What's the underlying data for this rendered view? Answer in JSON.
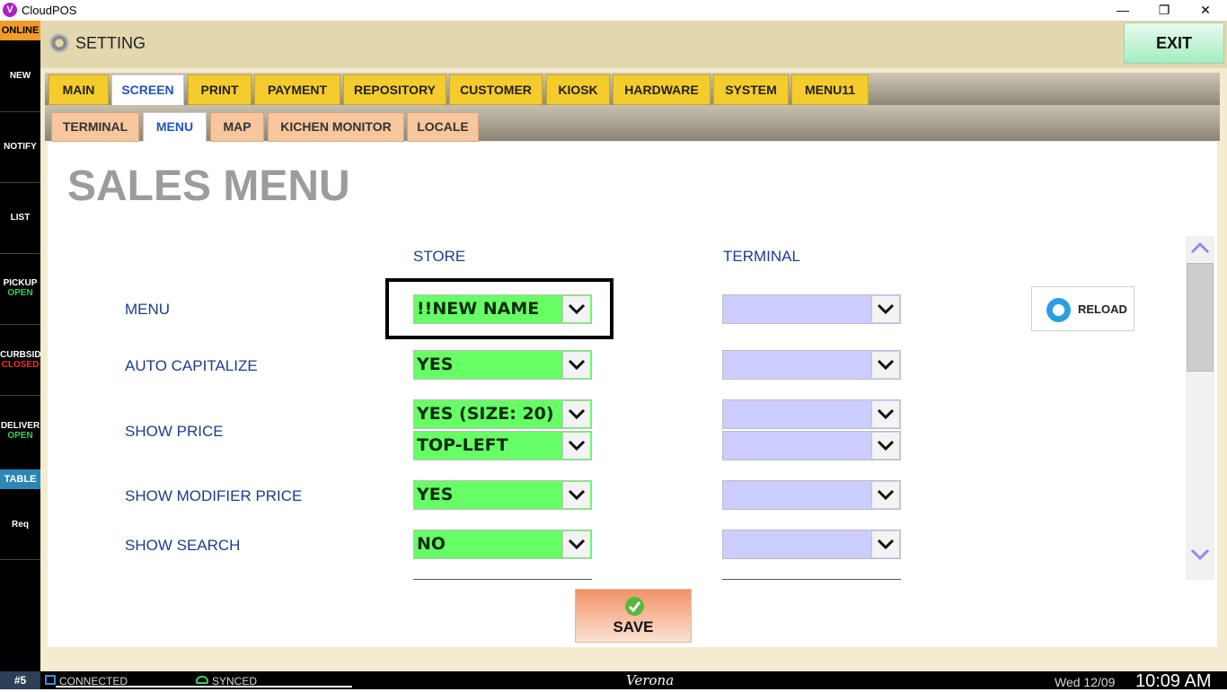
{
  "window": {
    "title": "CloudPOS",
    "logo_letter": "V",
    "minimize": "—",
    "restore": "❐",
    "close": "✕"
  },
  "sidebar": {
    "status": "ONLINE",
    "items": [
      {
        "label": "NEW",
        "sub": ""
      },
      {
        "label": "NOTIFY",
        "sub": ""
      },
      {
        "label": "LIST",
        "sub": ""
      },
      {
        "label": "PICKUP",
        "sub": "OPEN"
      },
      {
        "label": "CURBSID",
        "sub": "CLOSED"
      },
      {
        "label": "DELIVER",
        "sub": "OPEN"
      }
    ],
    "table": "TABLE",
    "req": "Req"
  },
  "header": {
    "title": "SETTING",
    "exit": "EXIT"
  },
  "tabs": [
    "MAIN",
    "SCREEN",
    "PRINT",
    "PAYMENT",
    "REPOSITORY",
    "CUSTOMER",
    "KIOSK",
    "HARDWARE",
    "SYSTEM",
    "MENU11"
  ],
  "active_tab": "SCREEN",
  "subtabs": [
    "TERMINAL",
    "MENU",
    "MAP",
    "KICHEN MONITOR",
    "LOCALE"
  ],
  "active_subtab": "MENU",
  "page": {
    "title": "SALES MENU",
    "columns": {
      "store": "STORE",
      "terminal": "TERMINAL"
    },
    "rows": [
      {
        "label": "MENU",
        "store": [
          "!!NEW NAME"
        ],
        "terminal": [
          ""
        ]
      },
      {
        "label": "AUTO CAPITALIZE",
        "store": [
          "YES"
        ],
        "terminal": [
          ""
        ]
      },
      {
        "label": "SHOW PRICE",
        "store": [
          "YES (SIZE: 20)",
          "TOP-LEFT"
        ],
        "terminal": [
          "",
          ""
        ]
      },
      {
        "label": "SHOW MODIFIER PRICE",
        "store": [
          "YES"
        ],
        "terminal": [
          ""
        ]
      },
      {
        "label": "SHOW SEARCH",
        "store": [
          "NO"
        ],
        "terminal": [
          ""
        ]
      }
    ],
    "reload": "RELOAD",
    "save": "SAVE"
  },
  "status_bar": {
    "terminal": "#5",
    "connection": "CONNECTED",
    "sync": "SYNCED",
    "venue": "Verona",
    "date": "Wed 12/09",
    "time": "10:09 AM"
  },
  "colors": {
    "store_field": "#66ff66",
    "terminal_field": "#ccccff",
    "active_tab_text": "#1f56b9",
    "tab": "#f5cc2d",
    "subtab": "#f7c69d",
    "header": "#e3d7ae"
  }
}
